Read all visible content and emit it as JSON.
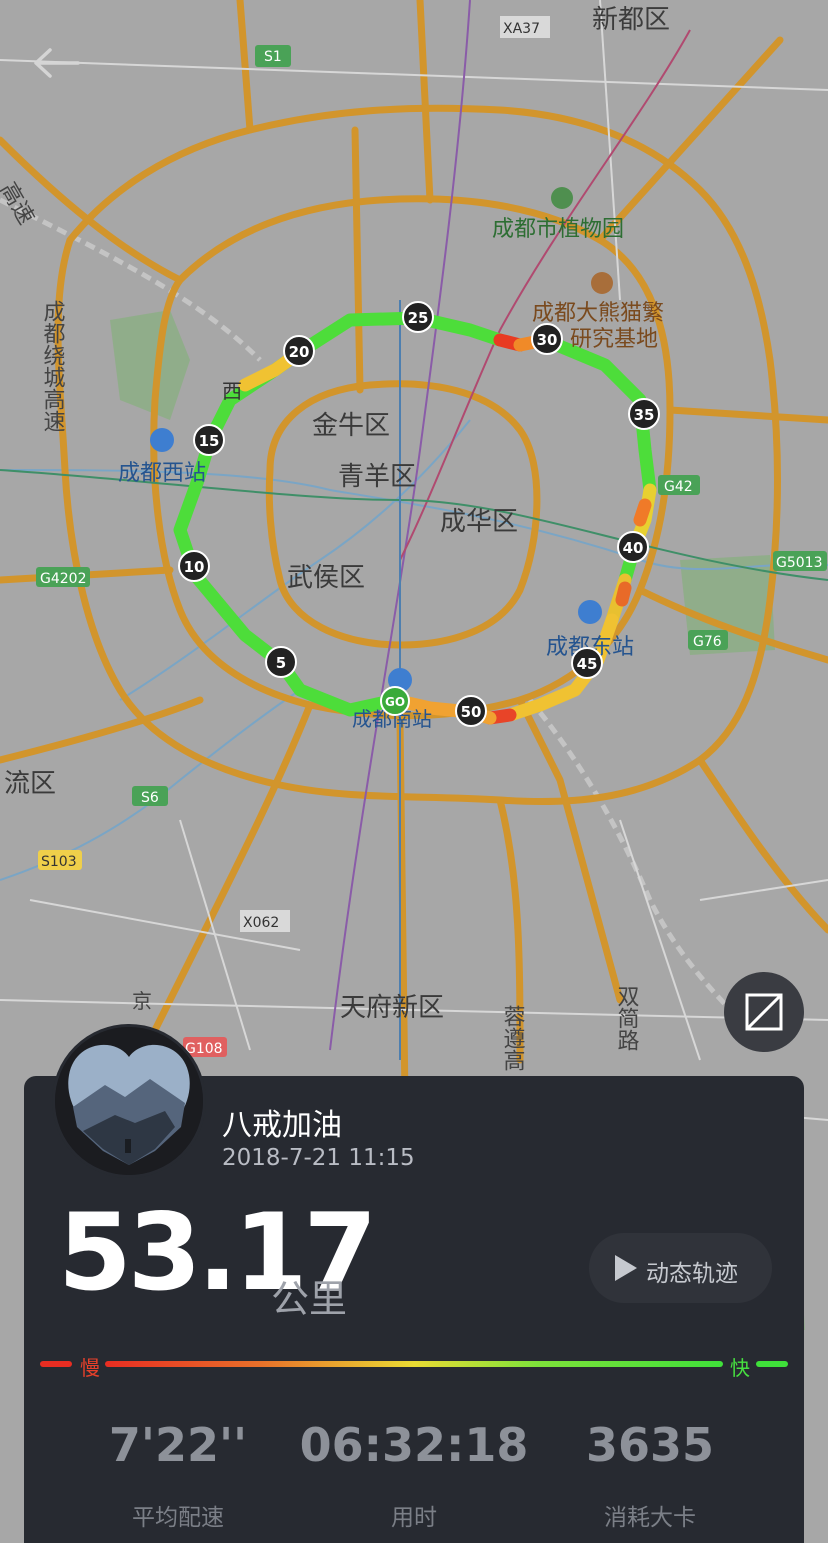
{
  "map": {
    "labels": {
      "xinduqu": "新都区",
      "xa37": "XA37",
      "s1": "S1",
      "botanical": "成都市植物园",
      "panda_1": "成都大熊猫繁",
      "panda_2": "研究基地",
      "gaosu": "高速",
      "raocheng": "成都绕城高速",
      "jinniu": "金牛区",
      "qingyang": "青羊区",
      "chenghua": "成华区",
      "wuhou": "武侯区",
      "chengdu_west": "成都西站",
      "chengdu_east": "成都东站",
      "chengdu_south": "成都南站",
      "g42": "G42",
      "g4202": "G4202",
      "g5013": "G5013",
      "g76": "G76",
      "s6": "S6",
      "s103": "S103",
      "x062": "X062",
      "g108": "G108",
      "liuqu": "流区",
      "tianfu": "天府新区",
      "rongzun": "蓉遵高",
      "shuangnan": "双简路",
      "jing": "京",
      "xi": "西"
    },
    "km_markers": [
      "5",
      "10",
      "15",
      "20",
      "25",
      "30",
      "35",
      "40",
      "45",
      "50"
    ],
    "start_marker": "GO",
    "colors": {
      "fast": "#4cdc3c",
      "mid": "#e8e030",
      "slow": "#e83020",
      "road": "#d89a2c",
      "water": "#6aa0c8",
      "park": "#8fb48a"
    }
  },
  "user": {
    "name": "八戒加油",
    "date": "2018-7-21 11:15"
  },
  "summary": {
    "distance": "53.17",
    "unit": "公里",
    "replay_label": "动态轨迹"
  },
  "pace_scale": {
    "slow_label": "慢",
    "fast_label": "快"
  },
  "stats": [
    {
      "value": "7'22''",
      "label": "平均配速"
    },
    {
      "value": "06:32:18",
      "label": "用时"
    },
    {
      "value": "3635",
      "label": "消耗大卡"
    }
  ]
}
